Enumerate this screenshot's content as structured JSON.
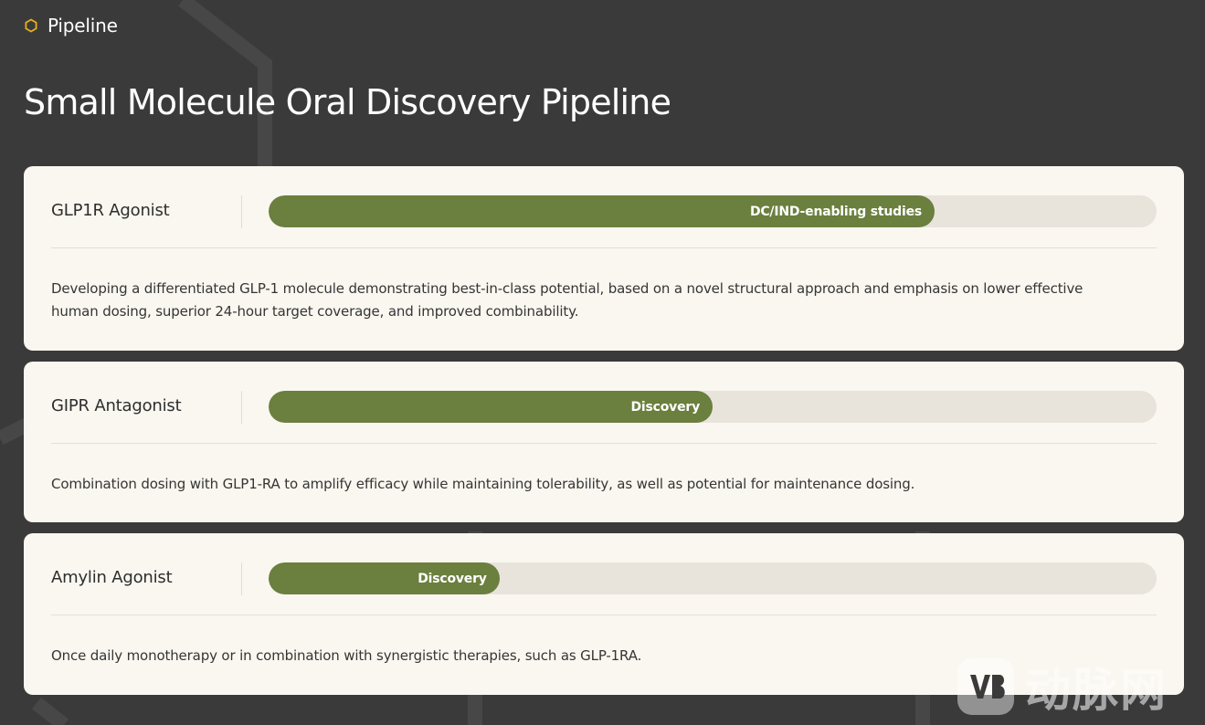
{
  "header": {
    "eyebrow_icon": "hexagon-outline-icon",
    "eyebrow_label": "Pipeline",
    "title": "Small Molecule Oral Discovery Pipeline"
  },
  "colors": {
    "background": "#3a3a3a",
    "card": "#faf7f0",
    "progress_fill": "#6b7f3e",
    "progress_track": "#e8e4dc",
    "accent": "#e8b01e"
  },
  "programs": [
    {
      "name": "GLP1R Agonist",
      "stage": "DC/IND-enabling studies",
      "progress": 0.75,
      "description": "Developing a differentiated GLP-1 molecule demonstrating best-in-class potential, based on a novel structural approach and emphasis on lower effective human dosing, superior 24-hour target coverage, and improved combinability."
    },
    {
      "name": "GIPR Antagonist",
      "stage": "Discovery",
      "progress": 0.5,
      "description": "Combination dosing with GLP1-RA to amplify efficacy while maintaining tolerability, as well as potential for maintenance dosing."
    },
    {
      "name": "Amylin Agonist",
      "stage": "Discovery",
      "progress": 0.26,
      "description": "Once daily monotherapy or in combination with synergistic therapies, such as GLP-1RA."
    }
  ],
  "watermark": {
    "logo_icon": "vb-logo-icon",
    "text": "动脉网"
  }
}
